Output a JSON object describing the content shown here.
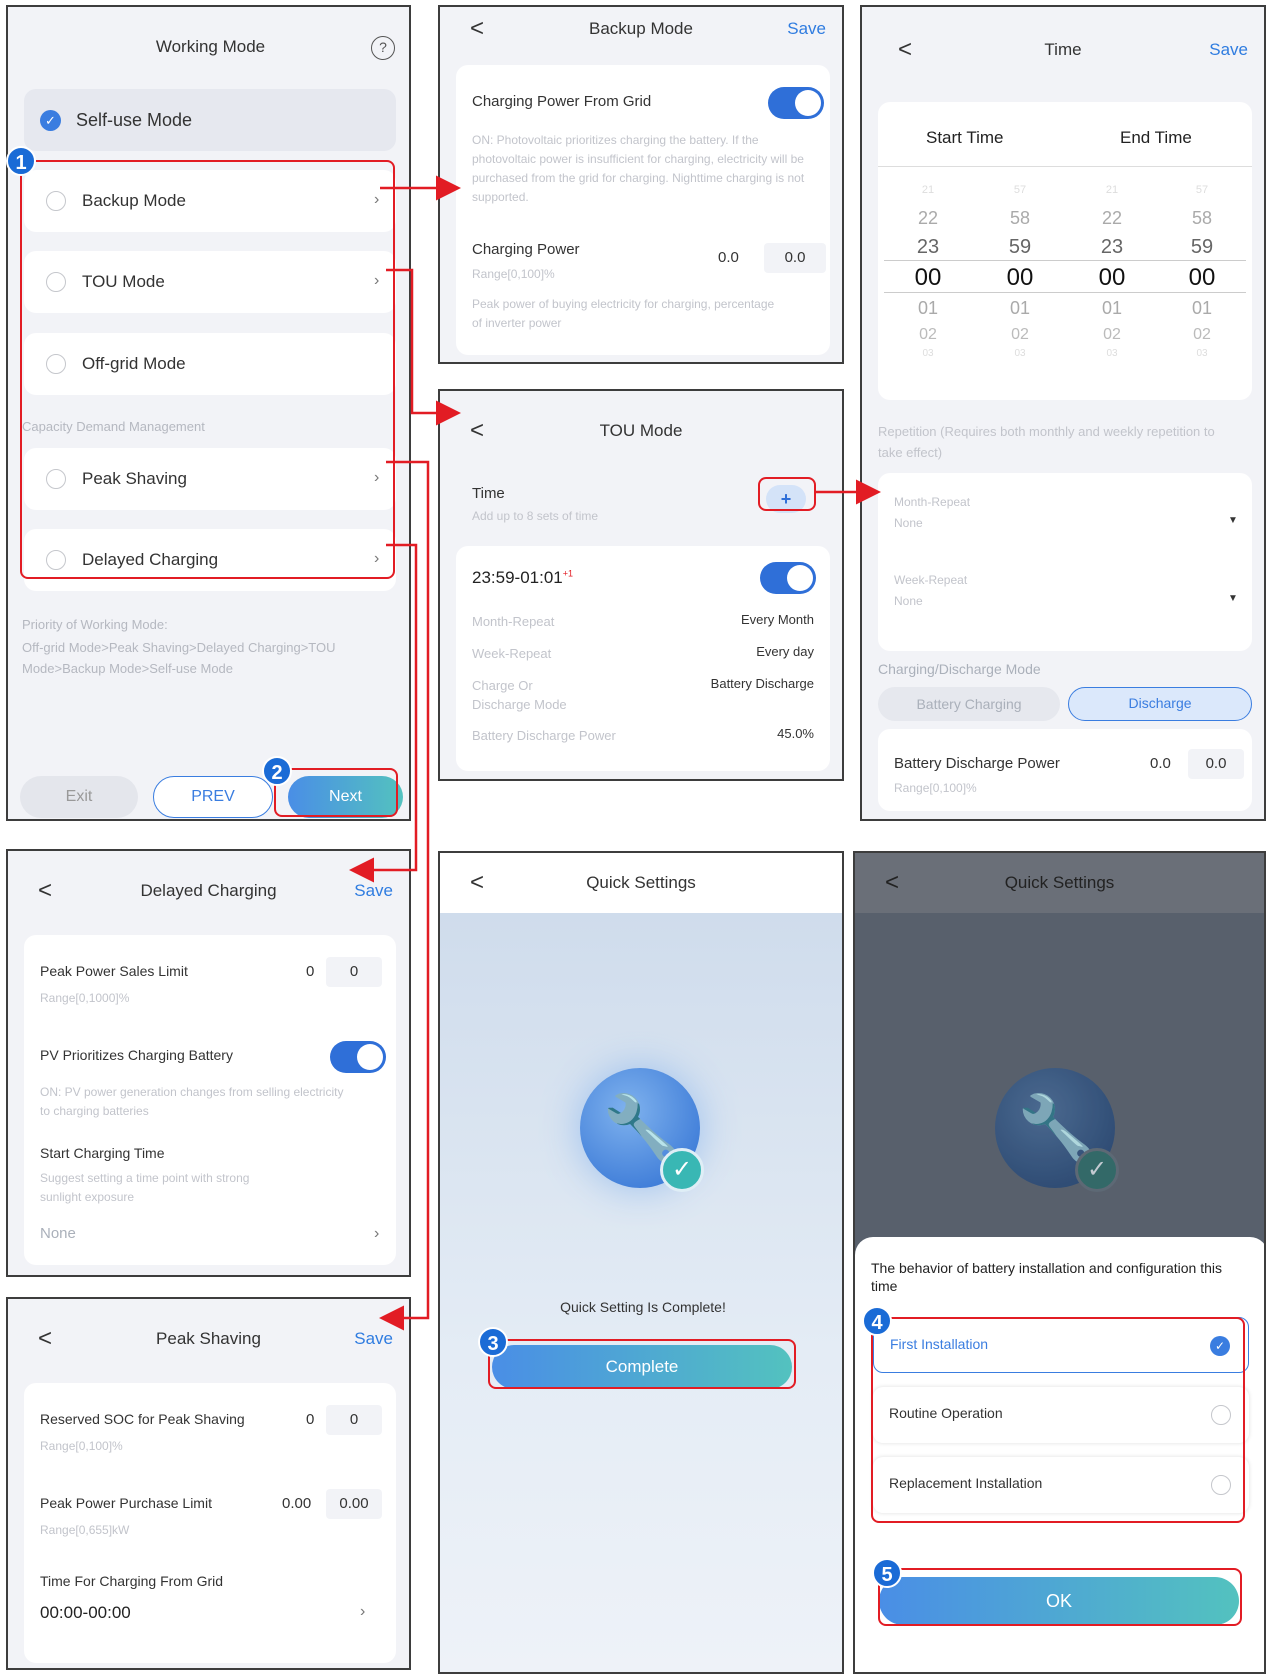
{
  "working_mode": {
    "title": "Working Mode",
    "help": "?",
    "self_use": "Self-use Mode",
    "backup": "Backup Mode",
    "tou": "TOU Mode",
    "offgrid": "Off-grid Mode",
    "section": "Capacity Demand Management",
    "peak": "Peak Shaving",
    "delayed": "Delayed Charging",
    "priority_title": "Priority of Working Mode:",
    "priority_text": "Off-grid Mode>Peak Shaving>Delayed Charging>TOU Mode>Backup Mode>Self-use Mode",
    "exit": "Exit",
    "prev": "PREV",
    "next": "Next"
  },
  "backup_mode": {
    "back": "<",
    "title": "Backup Mode",
    "save": "Save",
    "cpfg_label": "Charging Power From Grid",
    "cpfg_desc": "ON: Photovoltaic prioritizes charging the battery. If the photovoltaic power is insufficient for charging, electricity will be purchased from the grid for charging. Nighttime charging is not supported.",
    "cp_label": "Charging Power",
    "cp_value": "0.0",
    "cp_input": "0.0",
    "cp_range": "Range[0,100]%",
    "cp_desc": "Peak power of buying electricity for charging, percentage of inverter power"
  },
  "time": {
    "back": "<",
    "title": "Time",
    "save": "Save",
    "start": "Start Time",
    "end": "End Time",
    "picker": [
      [
        "21",
        "22",
        "23",
        "00",
        "01",
        "02",
        "03"
      ],
      [
        "57",
        "58",
        "59",
        "00",
        "01",
        "02",
        "03"
      ],
      [
        "21",
        "22",
        "23",
        "00",
        "01",
        "02",
        "03"
      ],
      [
        "57",
        "58",
        "59",
        "00",
        "01",
        "02",
        "03"
      ]
    ],
    "repetition": "Repetition (Requires both monthly and weekly repetition to take effect)",
    "month_label": "Month-Repeat",
    "month_value": "None",
    "week_label": "Week-Repeat",
    "week_value": "None",
    "mode_label": "Charging/Discharge Mode",
    "opt_charge": "Battery Charging",
    "opt_discharge": "Discharge",
    "bdp_label": "Battery Discharge Power",
    "bdp_value": "0.0",
    "bdp_input": "0.0",
    "bdp_range": "Range[0,100]%"
  },
  "tou": {
    "back": "<",
    "title": "TOU Mode",
    "time_label": "Time",
    "time_hint": "Add up to 8 sets of time",
    "add": "+",
    "slot": "23:59-01:01",
    "slot_sup": "+1",
    "r1_label": "Month-Repeat",
    "r1_value": "Every Month",
    "r2_label": "Week-Repeat",
    "r2_value": "Every day",
    "r3_label": "Charge Or Discharge Mode",
    "r3_value": "Battery Discharge",
    "r4_label": "Battery Discharge Power",
    "r4_value": "45.0%"
  },
  "delayed": {
    "back": "<",
    "title": "Delayed Charging",
    "save": "Save",
    "pps_label": "Peak Power Sales Limit",
    "pps_value": "0",
    "pps_input": "0",
    "pps_range": "Range[0,1000]%",
    "pv_label": "PV Prioritizes Charging Battery",
    "pv_desc": "ON: PV power generation changes from selling electricity to charging batteries",
    "sct_label": "Start Charging Time",
    "sct_desc": "Suggest setting a time point with strong sunlight exposure",
    "sct_value": "None"
  },
  "peak": {
    "back": "<",
    "title": "Peak Shaving",
    "save": "Save",
    "soc_label": "Reserved SOC for Peak Shaving",
    "soc_value": "0",
    "soc_input": "0",
    "soc_range": "Range[0,100]%",
    "ppp_label": "Peak Power Purchase Limit",
    "ppp_value": "0.00",
    "ppp_input": "0.00",
    "ppp_range": "Range[0,655]kW",
    "tcg_label": "Time For Charging From Grid",
    "tcg_value": "00:00-00:00"
  },
  "quick1": {
    "back": "<",
    "title": "Quick Settings",
    "msg": "Quick Setting Is Complete!",
    "complete": "Complete"
  },
  "quick2": {
    "back": "<",
    "title": "Quick Settings",
    "sheet_title": "The behavior of battery installation and configuration this time",
    "opt1": "First Installation",
    "opt2": "Routine Operation",
    "opt3": "Replacement Installation",
    "ok": "OK"
  },
  "badges": [
    "1",
    "2",
    "3",
    "4",
    "5"
  ],
  "colors": {
    "accent": "#2f6fd8",
    "link": "#2f7ce0",
    "annotation": "#e21c24"
  }
}
